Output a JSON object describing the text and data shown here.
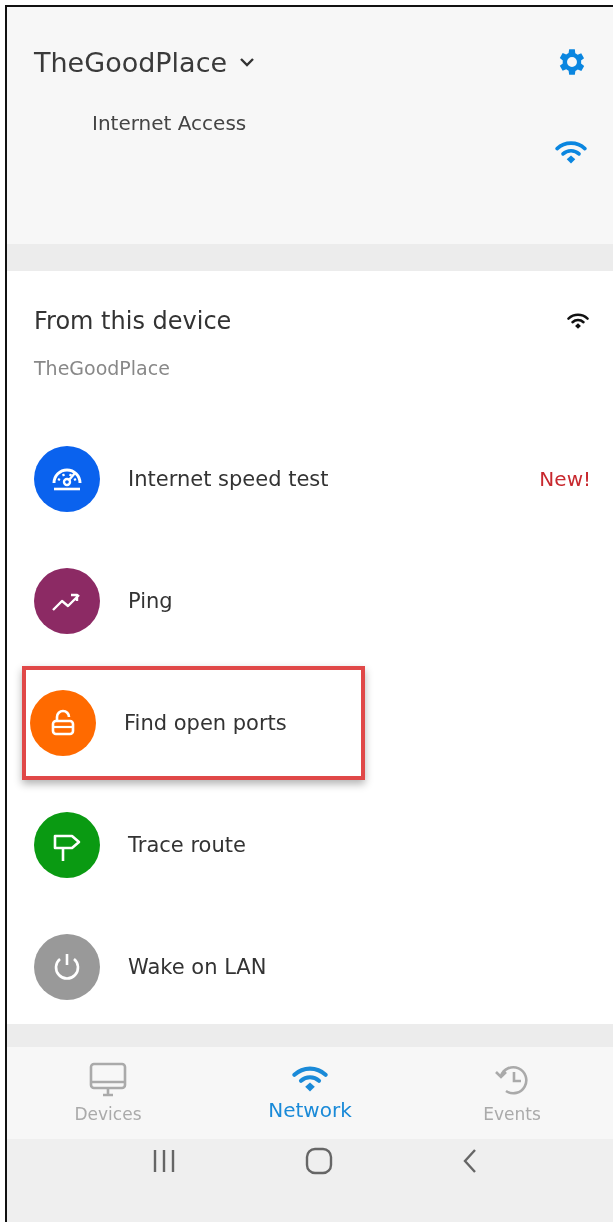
{
  "header": {
    "network_name": "TheGoodPlace",
    "status_label": "Internet Access"
  },
  "device_section": {
    "title": "From this device",
    "subtitle": "TheGoodPlace",
    "tools": [
      {
        "kind": "speed",
        "label": "Internet speed test",
        "badge": "New!",
        "color": "#0a62ee",
        "highlighted": false
      },
      {
        "kind": "ping",
        "label": "Ping",
        "color": "#8c2a64",
        "highlighted": false
      },
      {
        "kind": "ports",
        "label": "Find open ports",
        "color": "#ff6a00",
        "highlighted": true
      },
      {
        "kind": "trace",
        "label": "Trace route",
        "color": "#0a9a12",
        "highlighted": false
      },
      {
        "kind": "wake",
        "label": "Wake on LAN",
        "color": "#999999",
        "highlighted": false
      }
    ]
  },
  "bottom_nav": [
    {
      "kind": "devices",
      "label": "Devices",
      "selected": false
    },
    {
      "kind": "network",
      "label": "Network",
      "selected": true
    },
    {
      "kind": "events",
      "label": "Events",
      "selected": false
    }
  ]
}
